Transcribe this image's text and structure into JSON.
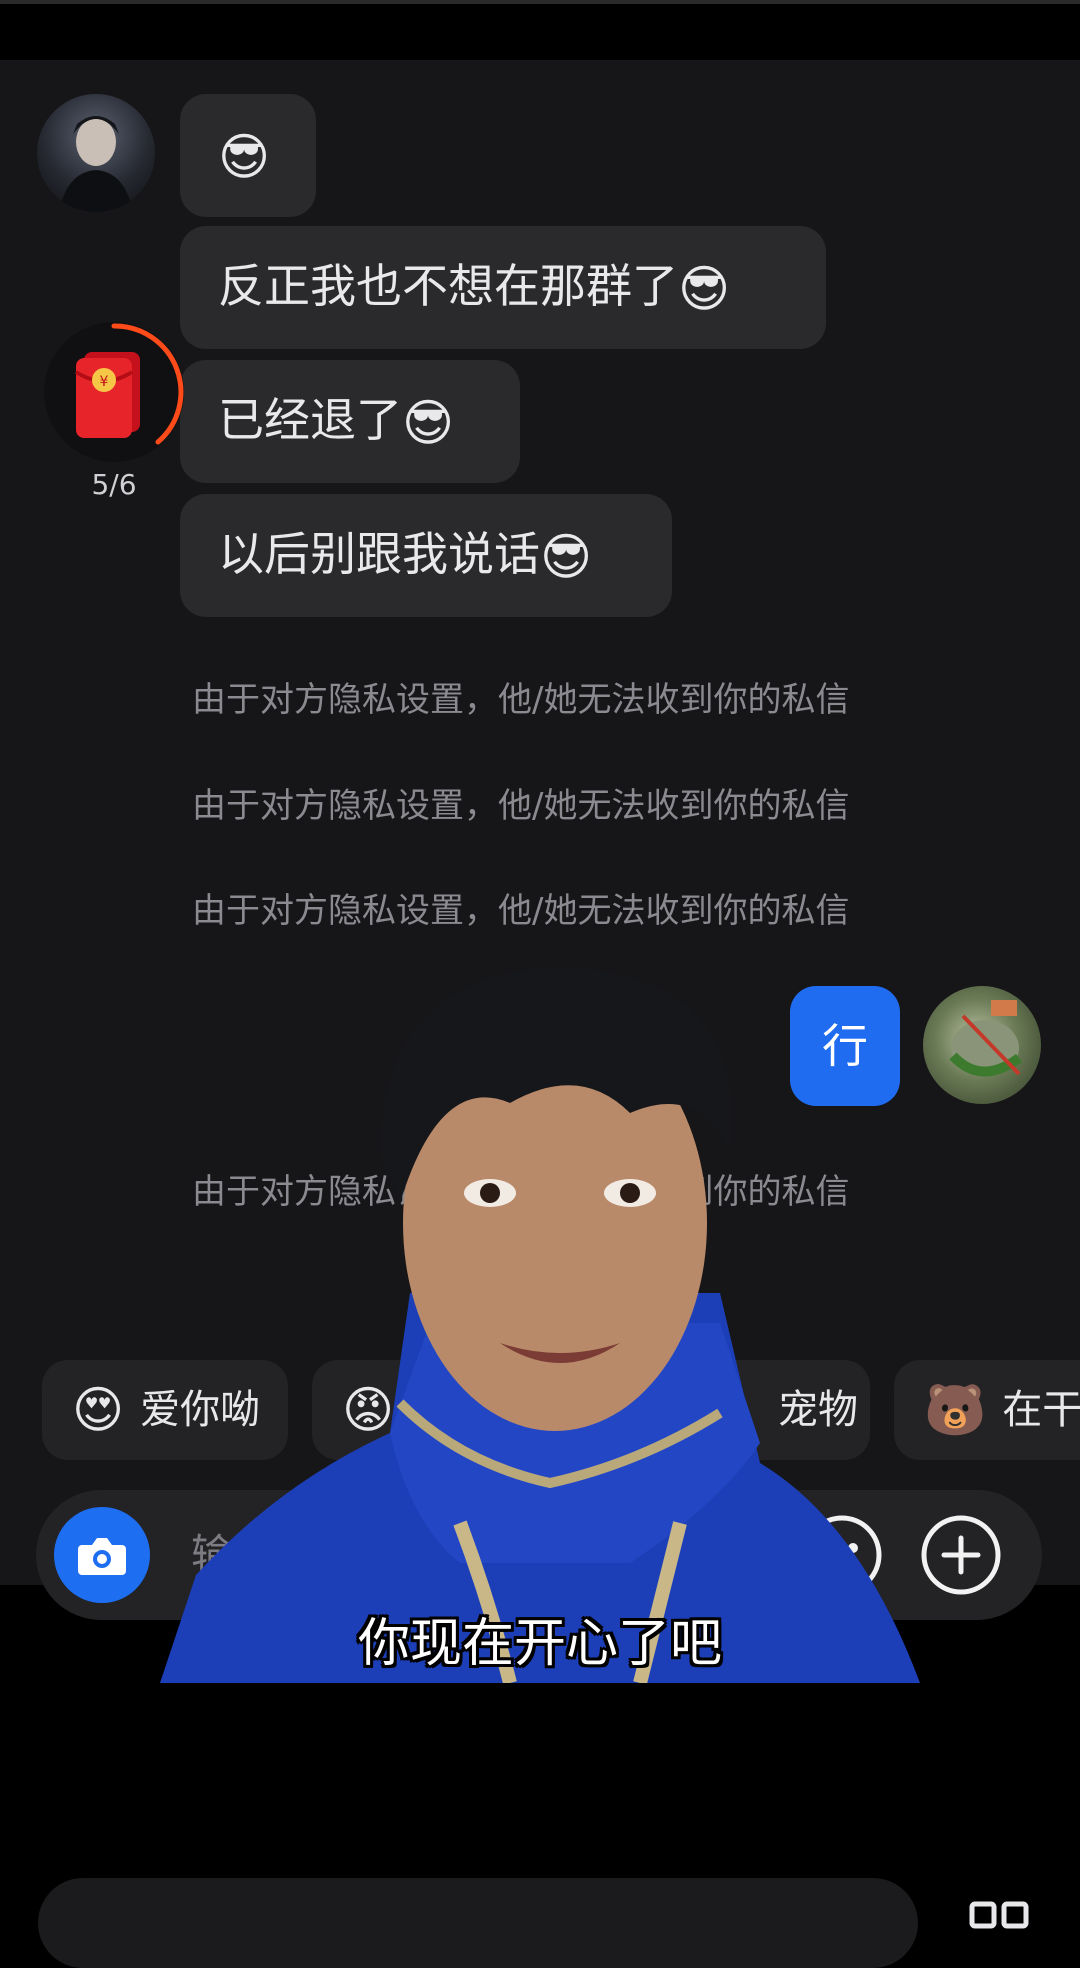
{
  "messages_received": [
    {
      "text": "",
      "emoji": "😎"
    },
    {
      "text": "反正我也不想在那群了",
      "emoji": "😎"
    },
    {
      "text": "已经退了",
      "emoji": "😎"
    },
    {
      "text": "以后别跟我说话",
      "emoji": "😎"
    }
  ],
  "red_packet": {
    "count": "5/6"
  },
  "privacy_notices": [
    "由于对方隐私设置，他/她无法收到你的私信",
    "由于对方隐私设置，他/她无法收到你的私信",
    "由于对方隐私设置，他/她无法收到你的私信",
    "由于对方隐私设置，他/她无法收到你的私信"
  ],
  "message_sent": {
    "text": "行"
  },
  "quick_replies": [
    {
      "emoji": "😍",
      "label": "爱你呦"
    },
    {
      "emoji": "😡",
      "label": ""
    },
    {
      "emoji": "",
      "label": "宠物"
    },
    {
      "emoji": "🐻",
      "label": "在干"
    }
  ],
  "input": {
    "placeholder": "输入消息"
  },
  "caption": "你现在开心了吧",
  "colors": {
    "accent_blue": "#1f6cf0",
    "bubble_dark": "#2a2a2d",
    "chat_bg": "#161618",
    "ring_orange": "#ff4a1a"
  }
}
